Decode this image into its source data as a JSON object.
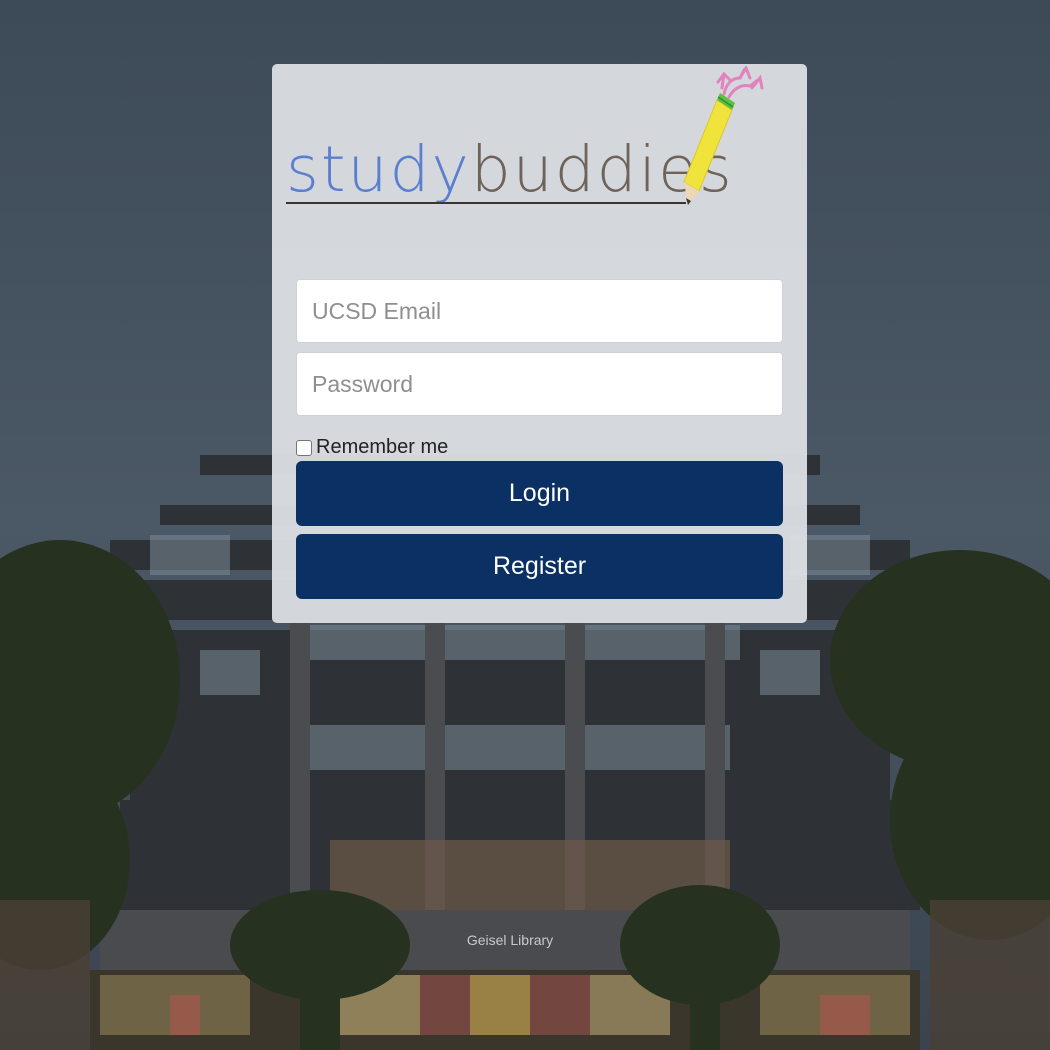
{
  "logo": {
    "word_study": "study",
    "word_buddies": "buddies"
  },
  "form": {
    "email_placeholder": "UCSD Email",
    "password_placeholder": "Password",
    "remember_label": "Remember me",
    "login_label": "Login",
    "register_label": "Register"
  },
  "background": {
    "sign_text": "Geisel Library"
  },
  "colors": {
    "button": "#0b3164",
    "logo_study": "#5b7fcf",
    "logo_buddies": "#6e6259"
  }
}
